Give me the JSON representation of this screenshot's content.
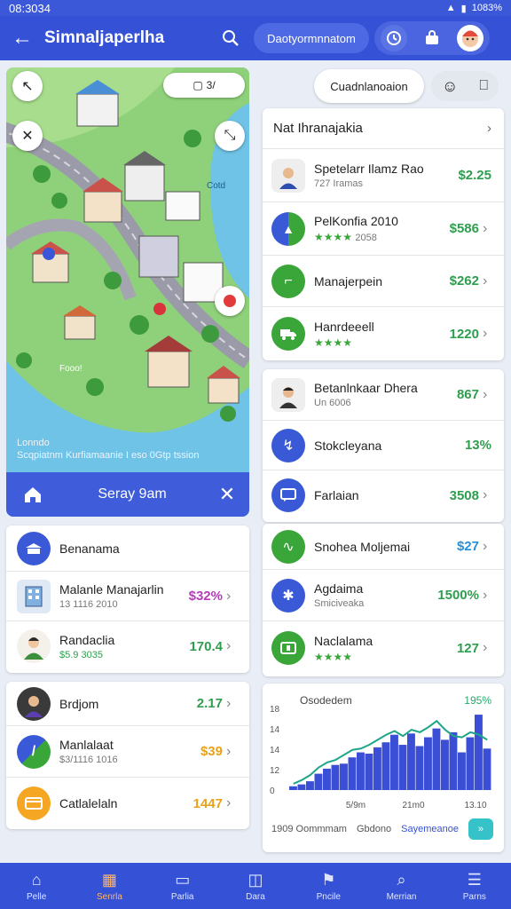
{
  "status": {
    "time": "08:3034",
    "battery": "1083%"
  },
  "appbar": {
    "title": "Simnaljaperlha",
    "pill": "Daotyormnnatom"
  },
  "map": {
    "chip_text": "3/",
    "caption_line1": "Lonndo",
    "caption_line2": "Scqpiatnm Kurfiamaanie I eso 0Gtp tssion",
    "water_label": "Fooo!",
    "island_label": "Cotd",
    "bar_label": "Seray 9am"
  },
  "search_pill": "Cuadnlanoaion",
  "right_top": {
    "header": "Nat Ihranajakia",
    "rows": [
      {
        "name": "Spetelarr Ilamz Rao",
        "sub": "727 Iramas",
        "value": "$2.25",
        "color": "#2e9e4e"
      },
      {
        "name": "PelKonfia 2010",
        "sub": "2058",
        "stars": "★★★★",
        "value": "$586",
        "color": "#2e9e4e"
      },
      {
        "name": "Manajerpein",
        "sub": "",
        "value": "$262",
        "color": "#2e9e4e"
      },
      {
        "name": "Hanrdeeell",
        "sub": "",
        "stars": "★★★★",
        "value": "1220",
        "color": "#2e9e4e"
      }
    ]
  },
  "right_mid": {
    "rows": [
      {
        "name": "Betanlnkaar Dhera",
        "sub": "Un 6006",
        "value": "867",
        "color": "#2e9e4e"
      },
      {
        "name": "Stokcleyana",
        "sub": "",
        "value": "13%",
        "color": "#2e9e4e"
      },
      {
        "name": "Farlaian",
        "sub": "",
        "value": "3508",
        "color": "#2e9e4e"
      }
    ]
  },
  "right_low": {
    "rows": [
      {
        "name": "Snohea Moljemai",
        "sub": "",
        "value": "$27",
        "color": "#2a8fd6"
      },
      {
        "name": "Agdaima",
        "sub": "Smiciveaka",
        "value": "1500%",
        "color": "#2e9e4e"
      },
      {
        "name": "Naclalama",
        "sub": "",
        "stars": "★★★★",
        "value": "127",
        "color": "#2e9e4e"
      }
    ]
  },
  "left_a": {
    "rows": [
      {
        "name": "Benanama",
        "sub": "",
        "value": "",
        "color": "#333"
      },
      {
        "name": "Malanle Manajarlin",
        "sub": "13 1116 2010",
        "value": "$32%",
        "color": "#b23fb7"
      },
      {
        "name": "Randaclia",
        "sub": "$5.9 3035",
        "value": "170.4",
        "color": "#2e9e4e"
      }
    ]
  },
  "left_b": {
    "rows": [
      {
        "name": "Brdjom",
        "sub": "",
        "value": "2.17",
        "color": "#2e9e4e"
      },
      {
        "name": "Manlalaat",
        "sub": "$3/1116 1016",
        "value": "$39",
        "color": "#e8a21a"
      },
      {
        "name": "Catlalelaln",
        "sub": "",
        "value": "1447",
        "color": "#e8a21a"
      }
    ]
  },
  "chart": {
    "title": "Osodedem",
    "pct": "195%",
    "y_ticks": [
      "18",
      "14",
      "14",
      "12",
      "0"
    ],
    "x_ticks": [
      "5/9m",
      "21m0",
      "13.10"
    ],
    "foot_left": "1909 Oommmam",
    "foot_mid": "Gbdono",
    "foot_right": "Sayemeanoe",
    "colors": {
      "bars": "#3a4fd6",
      "line": "#1ea58a"
    },
    "bars": [
      6,
      9,
      14,
      26,
      34,
      40,
      42,
      52,
      60,
      58,
      68,
      76,
      88,
      72,
      90,
      70,
      84,
      98,
      80,
      92,
      60,
      84,
      120,
      66
    ],
    "line": [
      10,
      16,
      24,
      36,
      44,
      48,
      56,
      64,
      66,
      72,
      80,
      88,
      94,
      86,
      96,
      92,
      100,
      110,
      96,
      86,
      84,
      92,
      88,
      80
    ]
  },
  "nav": [
    {
      "label": "Pelle",
      "icon": "home-icon"
    },
    {
      "label": "Senrla",
      "icon": "store-icon"
    },
    {
      "label": "Parlia",
      "icon": "inbox-icon"
    },
    {
      "label": "Dara",
      "icon": "cart-icon"
    },
    {
      "label": "Pncile",
      "icon": "map-icon"
    },
    {
      "label": "Merrian",
      "icon": "search-icon"
    },
    {
      "label": "Parns",
      "icon": "list-icon"
    }
  ]
}
